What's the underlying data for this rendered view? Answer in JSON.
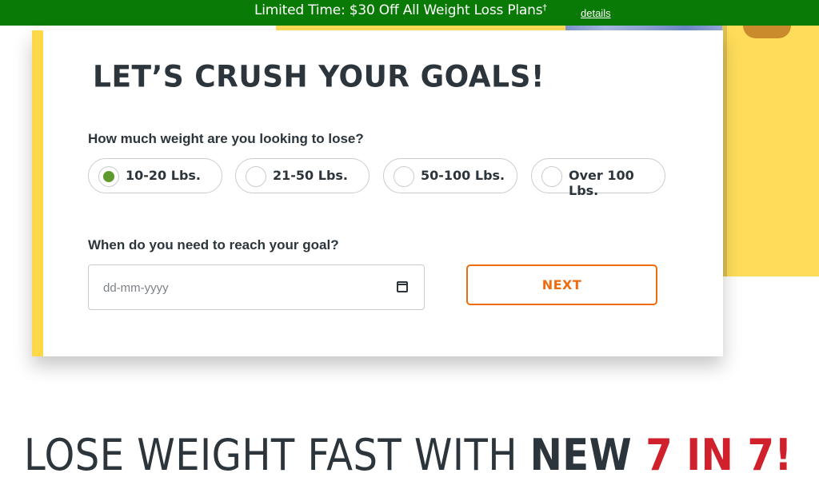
{
  "promo": {
    "text": "Limited Time: $30 Off All Weight Loss Plans",
    "dagger": "†",
    "link_label": "details"
  },
  "form": {
    "headline": "LET’S CRUSH YOUR GOALS!",
    "weight_question": "How much weight are you looking to lose?",
    "weight_options": [
      {
        "label": "10-20 Lbs.",
        "selected": true
      },
      {
        "label": "21-50 Lbs.",
        "selected": false
      },
      {
        "label": "50-100 Lbs.",
        "selected": false
      },
      {
        "label": "Over 100 Lbs.",
        "selected": false
      }
    ],
    "goal_question": "When do you need to reach your goal?",
    "date_placeholder": "dd-mm-yyyy",
    "next_label": "NEXT"
  },
  "hero": {
    "heading_plain": "LOSE WEIGHT FAST WITH ",
    "heading_bold": "NEW",
    "heading_accent": " 7 IN 7!"
  },
  "colors": {
    "promo_bg": "#0a7a06",
    "accent_yellow": "#ffd84a",
    "selected_green": "#5f9a2c",
    "next_orange": "#ee6b10",
    "heading_red": "#d0202b"
  }
}
